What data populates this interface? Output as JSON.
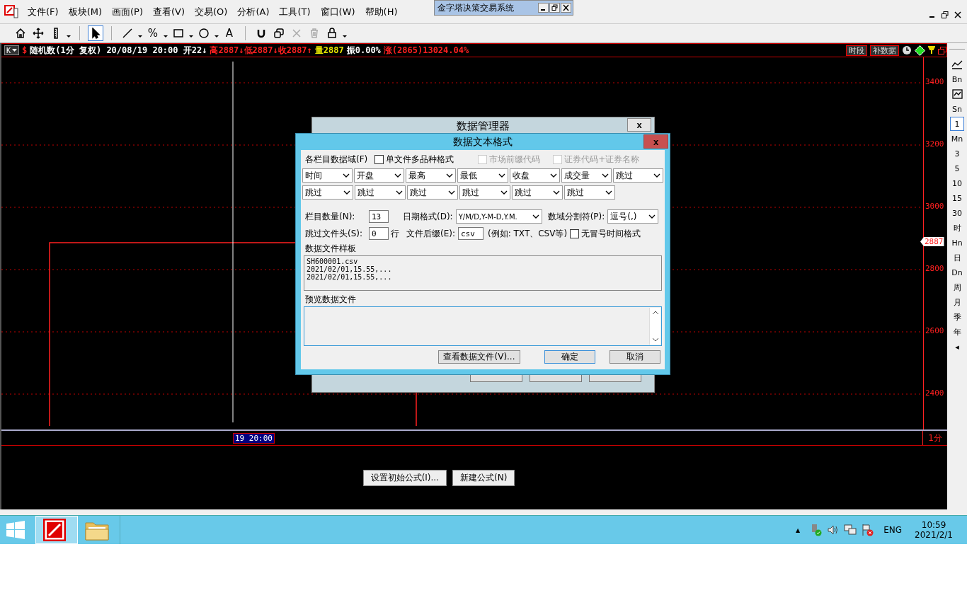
{
  "mini_window": {
    "title": "金字塔决策交易系统"
  },
  "menu": [
    "文件(F)",
    "板块(M)",
    "画面(P)",
    "查看(V)",
    "交易(O)",
    "分析(A)",
    "工具(T)",
    "窗口(W)",
    "帮助(H)"
  ],
  "toolbar": [
    {
      "kind": "home",
      "selected": false,
      "disabled": false
    },
    {
      "kind": "move",
      "selected": false,
      "disabled": false
    },
    {
      "kind": "ruler",
      "selected": false,
      "disabled": false
    },
    {
      "kind": "caret",
      "selected": false,
      "disabled": false
    },
    {
      "kind": "pointer",
      "selected": true,
      "disabled": false
    },
    {
      "kind": "line",
      "selected": false,
      "disabled": false
    },
    {
      "kind": "caret",
      "selected": false,
      "disabled": false
    },
    {
      "kind": "text",
      "label": "%",
      "selected": false,
      "disabled": false
    },
    {
      "kind": "caret",
      "selected": false,
      "disabled": false
    },
    {
      "kind": "rect",
      "selected": false,
      "disabled": false
    },
    {
      "kind": "caret",
      "selected": false,
      "disabled": false
    },
    {
      "kind": "circle",
      "selected": false,
      "disabled": false
    },
    {
      "kind": "caret",
      "selected": false,
      "disabled": false
    },
    {
      "kind": "text",
      "label": "A",
      "selected": false,
      "disabled": false
    },
    {
      "kind": "magnet",
      "selected": false,
      "disabled": false
    },
    {
      "kind": "copy",
      "selected": false,
      "disabled": false
    },
    {
      "kind": "delete",
      "selected": false,
      "disabled": true
    },
    {
      "kind": "trash",
      "selected": false,
      "disabled": true
    },
    {
      "kind": "lock",
      "selected": false,
      "disabled": false
    },
    {
      "kind": "caret",
      "selected": false,
      "disabled": false
    }
  ],
  "info_bar": {
    "mode": "K",
    "segments": [
      {
        "text": "$",
        "color": "#ff2020"
      },
      {
        "text": "随机数(1分 复权) 20/08/19 20:00 开22↓",
        "color": "#ffffff"
      },
      {
        "text": "高2887↓低2887↓收2887↑",
        "color": "#ff2020"
      },
      {
        "text": "量2887",
        "color": "#e8e800"
      },
      {
        "text": "振0.00%",
        "color": "#ffffff"
      },
      {
        "text": "涨(2865)13024.04%",
        "color": "#ff2020"
      }
    ],
    "buttons": [
      "时段",
      "补数据"
    ]
  },
  "y_axis_labels": [
    "3400",
    "3200",
    "3000",
    "2800",
    "2600",
    "2400"
  ],
  "price_tag": "2887",
  "time_cursor_label": "19 20:00",
  "period_label": "1分",
  "period_bar": [
    {
      "kind": "chart-icon",
      "selected": false
    },
    {
      "kind": "text",
      "label": "Bn",
      "selected": false
    },
    {
      "kind": "wave-icon",
      "selected": false
    },
    {
      "kind": "text",
      "label": "Sn",
      "selected": false
    },
    {
      "kind": "text",
      "label": "1",
      "selected": true
    },
    {
      "kind": "text",
      "label": "Mn",
      "selected": false
    },
    {
      "kind": "text",
      "label": "3",
      "selected": false
    },
    {
      "kind": "text",
      "label": "5",
      "selected": false
    },
    {
      "kind": "text",
      "label": "10",
      "selected": false
    },
    {
      "kind": "text",
      "label": "15",
      "selected": false
    },
    {
      "kind": "text",
      "label": "30",
      "selected": false
    },
    {
      "kind": "text",
      "label": "时",
      "selected": false
    },
    {
      "kind": "text",
      "label": "Hn",
      "selected": false
    },
    {
      "kind": "text",
      "label": "日",
      "selected": false
    },
    {
      "kind": "text",
      "label": "Dn",
      "selected": false
    },
    {
      "kind": "text",
      "label": "周",
      "selected": false
    },
    {
      "kind": "text",
      "label": "月",
      "selected": false
    },
    {
      "kind": "text",
      "label": "季",
      "selected": false
    },
    {
      "kind": "text",
      "label": "年",
      "selected": false
    },
    {
      "kind": "text",
      "label": "◂",
      "selected": false
    }
  ],
  "formula_buttons": [
    "设置初始公式(I)...",
    "新建公式(N)"
  ],
  "back_dialog": {
    "title": "数据管理器",
    "close": "x"
  },
  "dialog": {
    "title": "数据文本格式",
    "close": "x",
    "fields_label": "各栏目数据域(F)",
    "checkboxes": [
      {
        "label": "单文件多品种格式",
        "checked": false,
        "disabled": false
      },
      {
        "label": "市场前缀代码",
        "checked": false,
        "disabled": true
      },
      {
        "label": "证券代码+证券名称",
        "checked": false,
        "disabled": true
      }
    ],
    "column_rows": [
      [
        "时间",
        "开盘",
        "最高",
        "最低",
        "收盘",
        "成交量",
        "跳过"
      ],
      [
        "跳过",
        "跳过",
        "跳过",
        "跳过",
        "跳过",
        "跳过"
      ]
    ],
    "column_count": {
      "label": "栏目数量(N):",
      "value": "13"
    },
    "date_format": {
      "label": "日期格式(D):",
      "value": "Y/M/D,Y-M-D,Y.M."
    },
    "separator": {
      "label": "数域分割符(P):",
      "value": "逗号(,)"
    },
    "skip_header": {
      "label": "跳过文件头(S):",
      "value": "0",
      "unit": "行"
    },
    "suffix": {
      "label": "文件后缀(E):",
      "value": "csv",
      "hint": "(例如: TXT、CSV等)"
    },
    "no_colon": {
      "label": "无冒号时间格式",
      "checked": false
    },
    "sample_label": "数据文件样板",
    "sample_lines": [
      "SH600001.csv",
      "2021/02/01,15.55,...",
      "2021/02/01,15.55,..."
    ],
    "preview_label": "预览数据文件",
    "buttons": [
      {
        "label": "查看数据文件(V)...",
        "default": false
      },
      {
        "label": "确定",
        "default": true
      },
      {
        "label": "取消",
        "default": false
      }
    ]
  },
  "taskbar": {
    "apps": [
      {
        "kind": "app",
        "selected": true
      },
      {
        "kind": "folder",
        "selected": false
      }
    ],
    "tray_arrow": "▲",
    "language": "ENG",
    "time": "10:59",
    "date": "2021/2/1"
  }
}
